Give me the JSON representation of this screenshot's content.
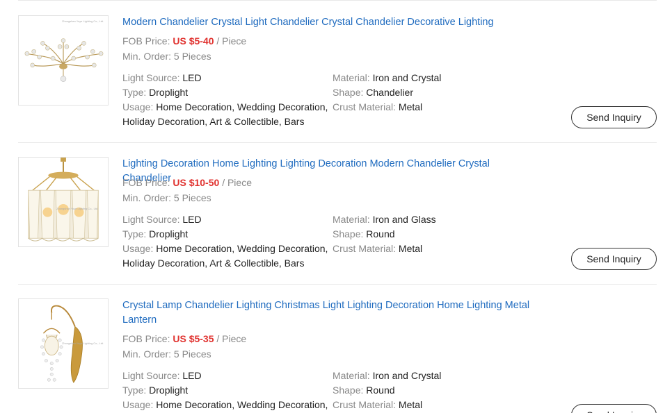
{
  "products": [
    {
      "title": "Modern Chandelier Crystal Light Chandelier Crystal Chandelier Decorative Lighting",
      "fob_label": "FOB Price:",
      "price": "US $5-40",
      "unit": "/ Piece",
      "moq_label": "Min. Order:",
      "moq": "5 Pieces",
      "light_source_label": "Light Source:",
      "light_source": "LED",
      "type_label": "Type:",
      "type": "Droplight",
      "usage_label": "Usage:",
      "usage": "Home Decoration, Wedding Decoration, Holiday Decoration, Art & Collectible, Bars",
      "material_label": "Material:",
      "material": "Iron and Crystal",
      "shape_label": "Shape:",
      "shape": "Chandelier",
      "crust_label": "Crust Material:",
      "crust": "Metal",
      "watermark": "Zhongshan Yoye Lighting Co., Ltd.",
      "button": "Send Inquiry"
    },
    {
      "title": "Lighting Decoration Home Lighting Lighting Decoration Modern Chandelier Crystal Chandelier",
      "fob_label": "FOB Price:",
      "price": "US $10-50",
      "unit": "/ Piece",
      "moq_label": "Min. Order:",
      "moq": "5 Pieces",
      "light_source_label": "Light Source:",
      "light_source": "LED",
      "type_label": "Type:",
      "type": "Droplight",
      "usage_label": "Usage:",
      "usage": "Home Decoration, Wedding Decoration, Holiday Decoration, Art & Collectible, Bars",
      "material_label": "Material:",
      "material": "Iron and Glass",
      "shape_label": "Shape:",
      "shape": "Round",
      "crust_label": "Crust Material:",
      "crust": "Metal",
      "watermark": "Zhongshan Yoye Lighting Co., Ltd.",
      "button": "Send Inquiry"
    },
    {
      "title": "Crystal Lamp Chandelier Lighting Christmas Light Lighting Decoration Home Lighting Metal Lantern",
      "fob_label": "FOB Price:",
      "price": "US $5-35",
      "unit": "/ Piece",
      "moq_label": "Min. Order:",
      "moq": "5 Pieces",
      "light_source_label": "Light Source:",
      "light_source": "LED",
      "type_label": "Type:",
      "type": "Droplight",
      "usage_label": "Usage:",
      "usage": "Home Decoration, Wedding Decoration,",
      "material_label": "Material:",
      "material": "Iron and Crystal",
      "shape_label": "Shape:",
      "shape": "Round",
      "crust_label": "Crust Material:",
      "crust": "Metal",
      "watermark": "Zhongshan Yoye Lighting Co., Ltd.",
      "button": "Send Inquiry"
    }
  ]
}
